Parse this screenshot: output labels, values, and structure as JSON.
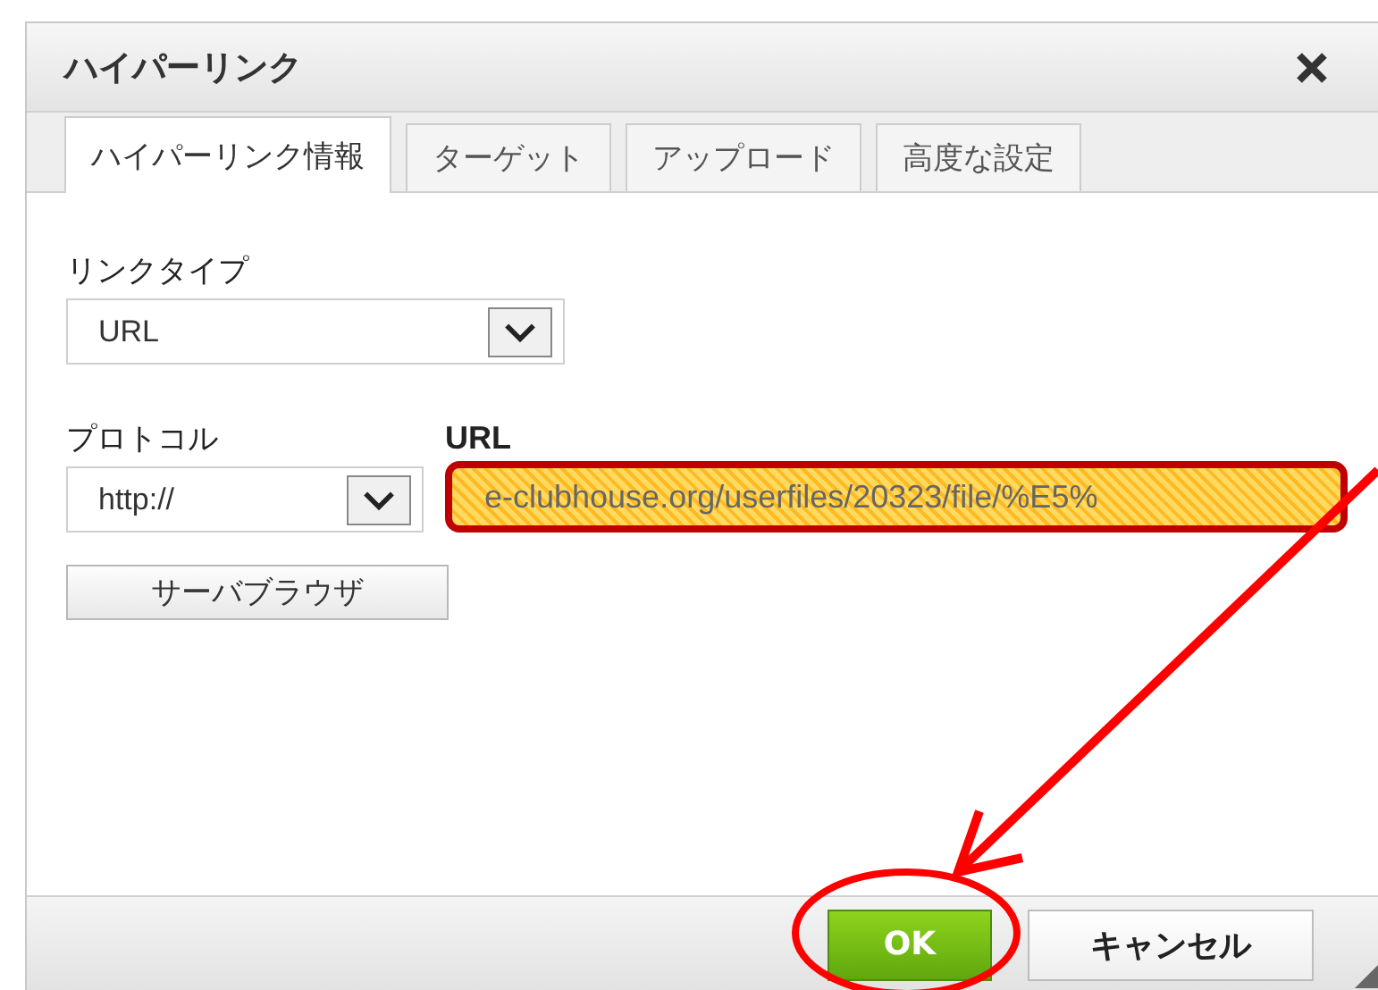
{
  "dialog": {
    "title": "ハイパーリンク"
  },
  "tabs": [
    {
      "label": "ハイパーリンク情報",
      "selected": true
    },
    {
      "label": "ターゲット",
      "selected": false
    },
    {
      "label": "アップロード",
      "selected": false
    },
    {
      "label": "高度な設定",
      "selected": false
    }
  ],
  "link_type": {
    "label": "リンクタイプ",
    "value": "URL"
  },
  "protocol": {
    "label": "プロトコル",
    "value": "http://"
  },
  "url": {
    "label": "URL",
    "value": "e-clubhouse.org/userfiles/20323/file/%E5%",
    "highlighted": true
  },
  "server_browser_button": "サーバブラウザ",
  "buttons": [
    {
      "label": "OK",
      "kind": "primary"
    },
    {
      "label": "キャンセル",
      "kind": "secondary"
    }
  ]
}
